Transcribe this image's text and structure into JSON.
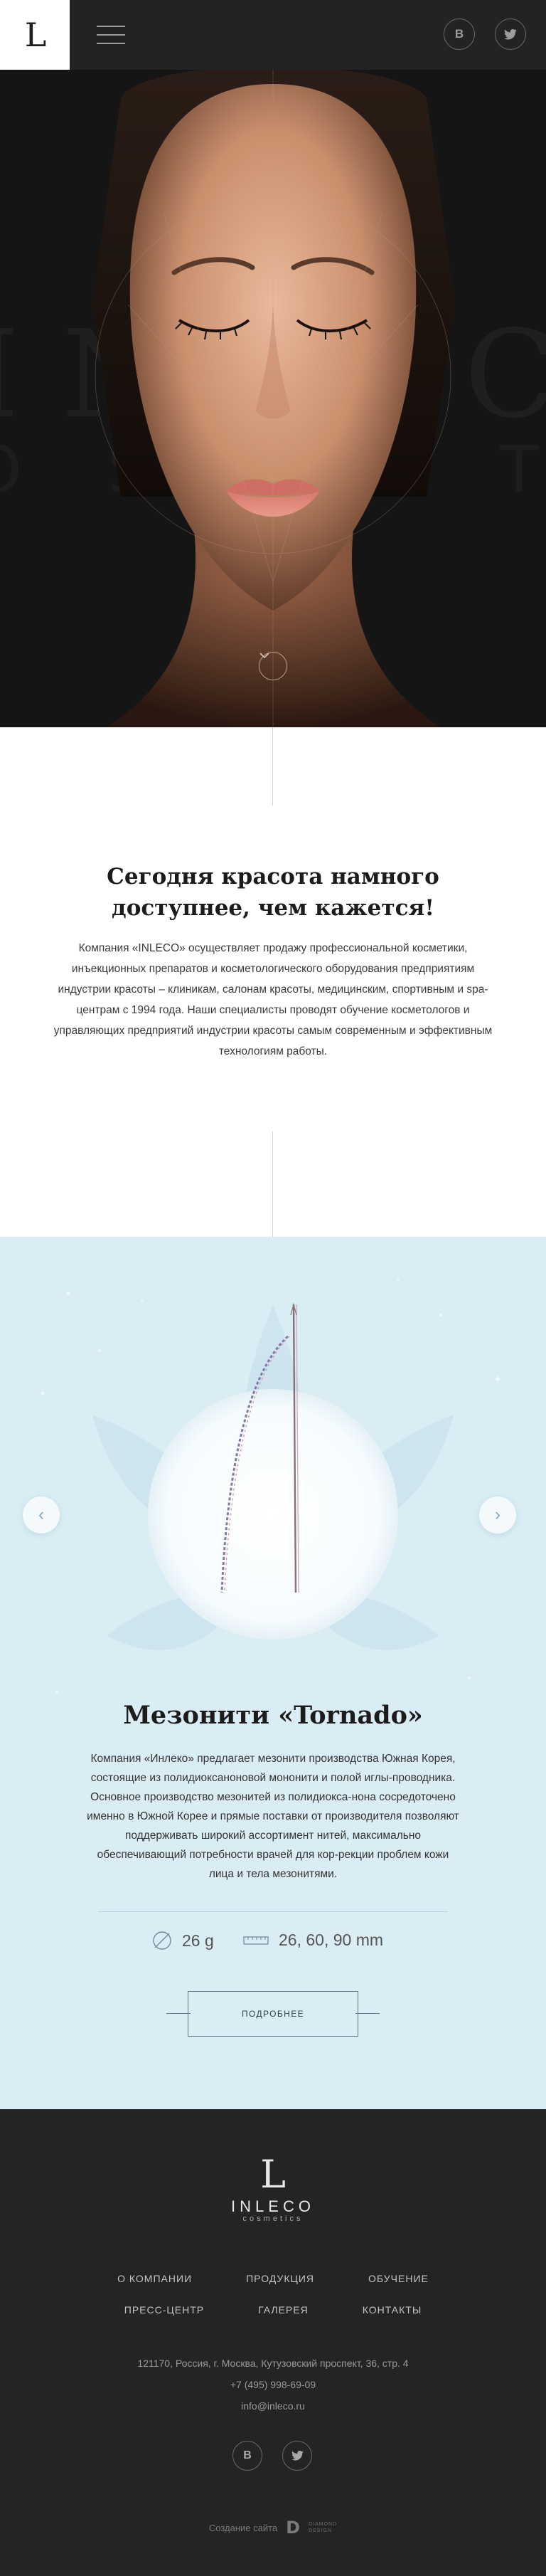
{
  "header": {
    "logo_letter": "L",
    "social": {
      "vk": "B",
      "twitter": "🐦"
    }
  },
  "hero": {
    "bg_letters": "INLECO",
    "bg_sub": "OSMETICS"
  },
  "intro": {
    "title": "Сегодня красота намного доступнее, чем кажется!",
    "text": "Компания «INLECO» осуществляет продажу профессиональной косметики, инъекционных препаратов и косметологического оборудования предприятиям индустрии красоты – клиникам, салонам красоты, медицинским, спортивным и spa-центрам с 1994 года.  Наши специалисты проводят обучение косметологов и управляющих предприятий индустрии красоты самым современным и эффективным технологиям работы."
  },
  "product": {
    "title": "Мезонити «Tornado»",
    "text": "Компания «Инлеко» предлагает мезонити производства Южная Корея, состоящие из полидиоксаноновой мононити и полой иглы-проводника. Основное производство мезонитей из полидиокса-нона сосредоточено именно в Южной Корее и прямые поставки от производителя позволяют поддерживать широкий ассортимент нитей, максимально обеспечивающий потребности врачей для кор-рекции проблем кожи лица и тела мезонитями.",
    "spec_weight": "26 g",
    "spec_length": "26, 60, 90 mm",
    "more_label": "ПОДРОБНЕЕ",
    "prev": "‹",
    "next": "›"
  },
  "footer": {
    "logo_letter": "L",
    "logo_name": "INLECO",
    "logo_sub": "cosmetics",
    "menu_row1": [
      "О КОМПАНИИ",
      "ПРОДУКЦИЯ",
      "ОБУЧЕНИЕ"
    ],
    "menu_row2": [
      "ПРЕСС-ЦЕНТР",
      "ГАЛЕРЕЯ",
      "КОНТАКТЫ"
    ],
    "address": "121170, Россия, г. Москва, Кутузовский проспект, 36, стр. 4",
    "phone": "+7 (495) 998-69-09",
    "email": "info@inleco.ru",
    "social": {
      "vk": "B",
      "twitter": "🐦"
    },
    "credit": "Создание сайта",
    "credit_logo": "D",
    "credit_logo_text_1": "DIAMOND",
    "credit_logo_text_2": "DESIGN"
  },
  "colors": {
    "header_bg": "#232323",
    "hero_bg": "#151515",
    "product_bg": "#daedf5",
    "footer_bg": "#242424"
  }
}
